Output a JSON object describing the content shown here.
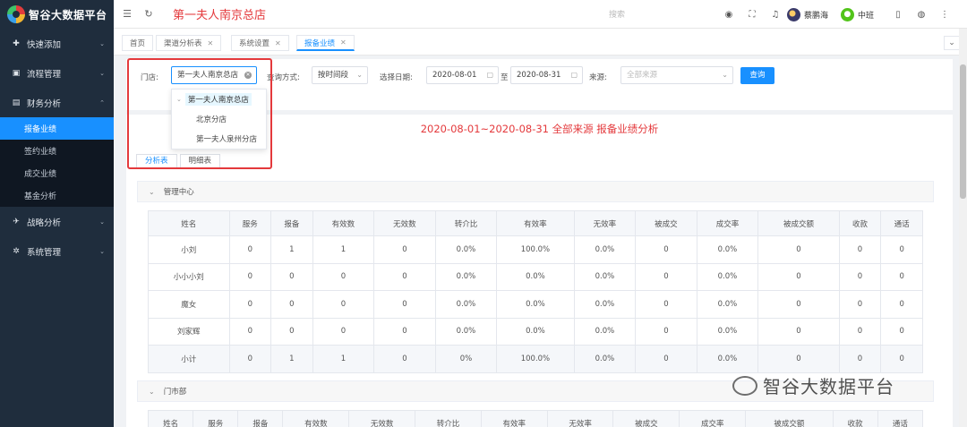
{
  "sidebar": {
    "logo": "智谷大数据平台",
    "menu": [
      {
        "label": "快速添加",
        "icon": "plus-circle-icon",
        "glyph": "✚"
      },
      {
        "label": "流程管理",
        "icon": "folder-icon",
        "glyph": "▣"
      },
      {
        "label": "财务分析",
        "icon": "chart-icon",
        "glyph": "▤"
      }
    ],
    "submenu": [
      {
        "label": "报备业绩"
      },
      {
        "label": "签约业绩"
      },
      {
        "label": "成交业绩"
      },
      {
        "label": "基金分析"
      }
    ],
    "menu2": [
      {
        "label": "战略分析",
        "icon": "plane-icon",
        "glyph": "✈"
      },
      {
        "label": "系统管理",
        "icon": "gear-icon",
        "glyph": "✲"
      }
    ]
  },
  "header": {
    "title": "第一夫人南京总店",
    "search_placeholder": "搜索",
    "user1": "蔡鹏海",
    "user2": "中班"
  },
  "tabs": [
    {
      "label": "首页"
    },
    {
      "label": "渠道分析表"
    },
    {
      "label": "系统设置"
    },
    {
      "label": "报备业绩"
    }
  ],
  "filter": {
    "store_label": "门店:",
    "store_value": "第一夫人南京总店",
    "query_mode_label": "查询方式:",
    "query_mode_value": "按时间段",
    "date_label": "选择日期:",
    "date_from": "2020-08-01",
    "date_sep": "至",
    "date_to": "2020-08-31",
    "source_label": "来源:",
    "source_placeholder": "全部来源",
    "query_button": "查询"
  },
  "dropdown": {
    "root": "第一夫人南京总店",
    "children": [
      "北京分店",
      "第一夫人泉州分店"
    ]
  },
  "report": {
    "title": "2020-08-01~2020-08-31 全部来源 报备业绩分析",
    "subtabs": [
      "分析表",
      "明细表"
    ],
    "columns": [
      "姓名",
      "服务",
      "报备",
      "有效数",
      "无效数",
      "转介比",
      "有效率",
      "无效率",
      "被成交",
      "成交率",
      "被成交额",
      "收款",
      "通话"
    ],
    "sections": [
      {
        "name": "管理中心",
        "rows": [
          [
            "小刘",
            "0",
            "1",
            "1",
            "0",
            "0.0%",
            "100.0%",
            "0.0%",
            "0",
            "0.0%",
            "0",
            "0",
            "0"
          ],
          [
            "小小小刘",
            "0",
            "0",
            "0",
            "0",
            "0.0%",
            "0.0%",
            "0.0%",
            "0",
            "0.0%",
            "0",
            "0",
            "0"
          ],
          [
            "魔女",
            "0",
            "0",
            "0",
            "0",
            "0.0%",
            "0.0%",
            "0.0%",
            "0",
            "0.0%",
            "0",
            "0",
            "0"
          ],
          [
            "刘家辉",
            "0",
            "0",
            "0",
            "0",
            "0.0%",
            "0.0%",
            "0.0%",
            "0",
            "0.0%",
            "0",
            "0",
            "0"
          ],
          [
            "小计",
            "0",
            "1",
            "1",
            "0",
            "0%",
            "100.0%",
            "0.0%",
            "0",
            "0.0%",
            "0",
            "0",
            "0"
          ]
        ]
      },
      {
        "name": "门市部",
        "rows": []
      }
    ]
  },
  "watermark": "智谷大数据平台"
}
